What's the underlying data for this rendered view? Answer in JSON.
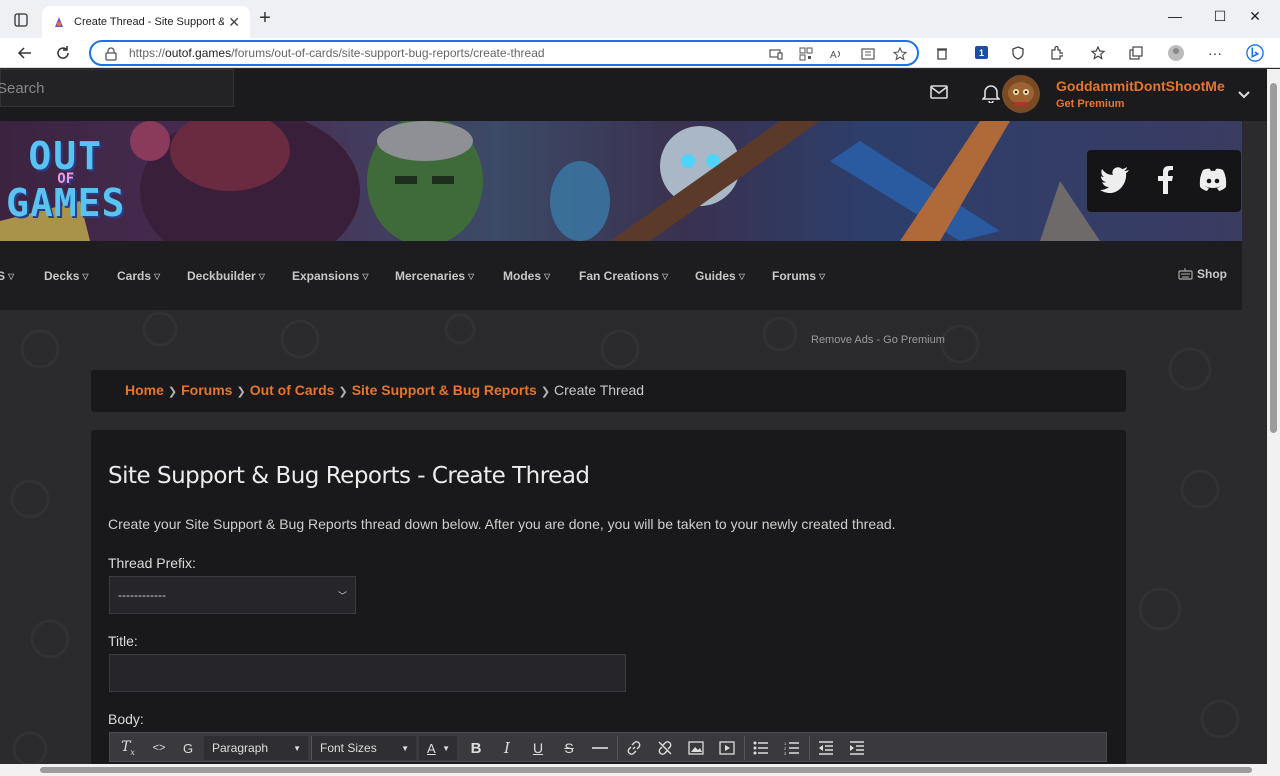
{
  "browser": {
    "tab_title": "Create Thread - Site Support & Bug Reports",
    "url_prefix": "https://",
    "url_host": "outof.games",
    "url_path": "/forums/out-of-cards/site-support-bug-reports/create-thread",
    "notification_count": "1"
  },
  "topbar": {
    "search_placeholder": "Search",
    "username": "GoddammitDontShootMe",
    "premium_label": "Get Premium"
  },
  "banner": {
    "logo_line1": "OUT",
    "logo_line2": "OF",
    "logo_line3": "GAMES"
  },
  "nav": {
    "items": [
      {
        "label": "S"
      },
      {
        "label": "Decks"
      },
      {
        "label": "Cards"
      },
      {
        "label": "Deckbuilder"
      },
      {
        "label": "Expansions"
      },
      {
        "label": "Mercenaries"
      },
      {
        "label": "Modes"
      },
      {
        "label": "Fan Creations"
      },
      {
        "label": "Guides"
      },
      {
        "label": "Forums"
      }
    ],
    "shop_label": "Shop"
  },
  "remove_ads": "Remove Ads - Go Premium",
  "breadcrumb": {
    "items": [
      "Home",
      "Forums",
      "Out of Cards",
      "Site Support & Bug Reports"
    ],
    "current": "Create Thread"
  },
  "form": {
    "heading": "Site Support & Bug Reports - Create Thread",
    "description": "Create your Site Support & Bug Reports thread down below. After you are done, you will be taken to your newly created thread.",
    "prefix_label": "Thread Prefix:",
    "prefix_value": "------------",
    "title_label": "Title:",
    "title_value": "",
    "body_label": "Body:"
  },
  "editor": {
    "paragraph_label": "Paragraph",
    "font_sizes_label": "Font Sizes",
    "g_label": "G",
    "code_label": "<>",
    "font_color_label": "A"
  },
  "colors": {
    "accent": "#e8742c",
    "page_bg": "#2b2b2d",
    "panel_bg": "#19191b"
  }
}
